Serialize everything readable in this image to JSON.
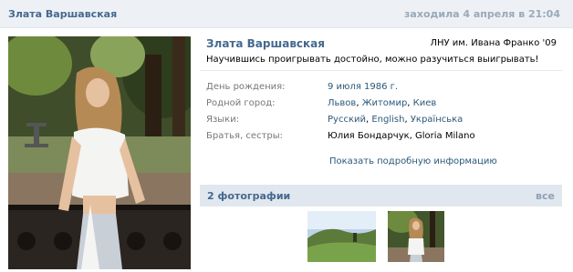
{
  "header": {
    "name": "Злата Варшавская",
    "status": "заходила 4 апреля в 21:04"
  },
  "profile": {
    "name": "Злата Варшавская",
    "school": "ЛНУ им. Ивана Франко '09",
    "motto": "Научившись проигрывать достойно, можно разучиться выигрывать!"
  },
  "details": [
    {
      "label": "День рождения:",
      "values": [
        "9 июля 1986 г."
      ]
    },
    {
      "label": "Родной город:",
      "values": [
        "Львов",
        "Житомир",
        "Киев"
      ]
    },
    {
      "label": "Языки:",
      "values": [
        "Русский",
        "English",
        "Українська"
      ]
    },
    {
      "label": "Братья, сестры:",
      "values": [
        "Юлия Бондарчук, Gloria Milano"
      ]
    }
  ],
  "more_link": "Показать подробную информацию",
  "photos": {
    "title": "2 фотографии",
    "all_label": "все"
  },
  "colors": {
    "link": "#2b587a",
    "name": "#45688e",
    "header_bg": "#edf1f5",
    "bar_bg": "#e1e7ee"
  }
}
